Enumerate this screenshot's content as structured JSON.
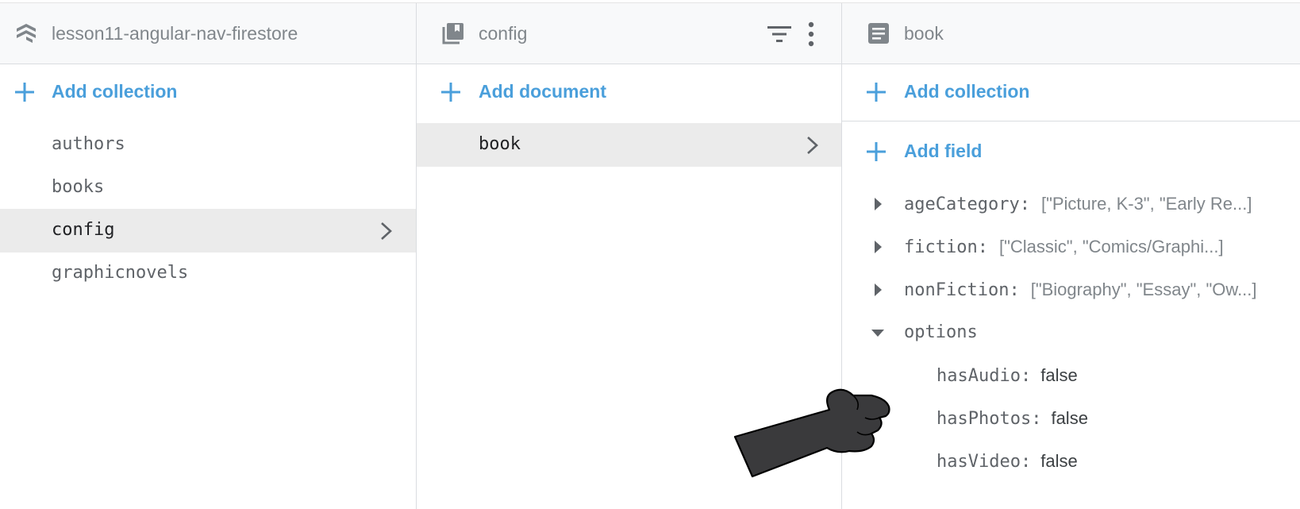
{
  "root_panel": {
    "title": "lesson11-angular-nav-firestore",
    "header_icon": "firestore-stack-icon",
    "add_label": "Add collection",
    "items": [
      {
        "label": "authors",
        "selected": false
      },
      {
        "label": "books",
        "selected": false
      },
      {
        "label": "config",
        "selected": true
      },
      {
        "label": "graphicnovels",
        "selected": false
      }
    ]
  },
  "collection_panel": {
    "title": "config",
    "header_icon": "collection-icon",
    "add_label": "Add document",
    "items": [
      {
        "label": "book",
        "selected": true
      }
    ]
  },
  "document_panel": {
    "title": "book",
    "header_icon": "document-icon",
    "add_collection_label": "Add collection",
    "add_field_label": "Add field",
    "fields": [
      {
        "key": "ageCategory:",
        "value": "[\"Picture, K-3\", \"Early Re...]",
        "expanded": false
      },
      {
        "key": "fiction:",
        "value": "[\"Classic\", \"Comics/Graphi...]",
        "expanded": false
      },
      {
        "key": "nonFiction:",
        "value": "[\"Biography\", \"Essay\", \"Ow...]",
        "expanded": false
      },
      {
        "key": "options",
        "value": "",
        "expanded": true
      }
    ],
    "child_fields": [
      {
        "key": "hasAudio:",
        "value": "false"
      },
      {
        "key": "hasPhotos:",
        "value": "false"
      },
      {
        "key": "hasVideo:",
        "value": "false"
      }
    ]
  },
  "colors": {
    "accent": "#4a9fdb",
    "selected_bg": "#ebebeb",
    "header_bg": "#f8f9fa",
    "cursor": "#3a3a3c"
  },
  "overlay": {
    "icon": "pointing-hand-cursor-icon"
  }
}
